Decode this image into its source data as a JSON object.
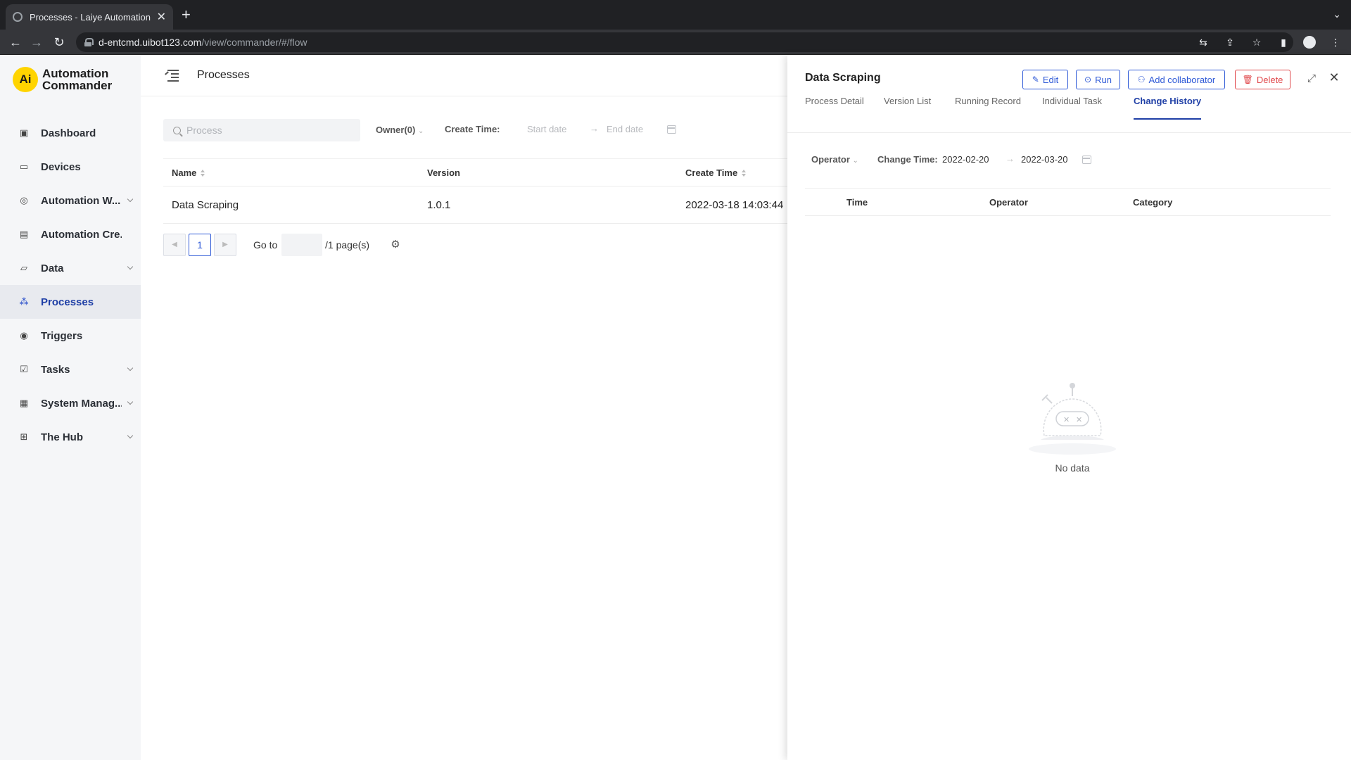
{
  "browser": {
    "tab_title": "Processes - Laiye Automation",
    "url_host": "d-entcmd.uibot123.com",
    "url_path": "/view/commander/#/flow"
  },
  "sidebar": {
    "logo_mark": "Ai",
    "logo_line1": "Automation",
    "logo_line2": "Commander",
    "items": [
      {
        "label": "Dashboard",
        "icon": "dashboard-icon",
        "has_caret": false,
        "active": false
      },
      {
        "label": "Devices",
        "icon": "devices-icon",
        "has_caret": false,
        "active": false
      },
      {
        "label": "Automation W...",
        "icon": "automation-workflow-icon",
        "has_caret": true,
        "active": false
      },
      {
        "label": "Automation Cre...",
        "icon": "automation-creator-icon",
        "has_caret": false,
        "active": false
      },
      {
        "label": "Data",
        "icon": "data-folder-icon",
        "has_caret": true,
        "active": false
      },
      {
        "label": "Processes",
        "icon": "processes-icon",
        "has_caret": false,
        "active": true
      },
      {
        "label": "Triggers",
        "icon": "triggers-icon",
        "has_caret": false,
        "active": false
      },
      {
        "label": "Tasks",
        "icon": "tasks-icon",
        "has_caret": true,
        "active": false
      },
      {
        "label": "System Manag...",
        "icon": "system-management-icon",
        "has_caret": true,
        "active": false
      },
      {
        "label": "The Hub",
        "icon": "hub-icon",
        "has_caret": true,
        "active": false
      }
    ]
  },
  "header": {
    "title": "Processes"
  },
  "filters": {
    "search_placeholder": "Process",
    "owner_label": "Owner(0)",
    "create_time_label": "Create Time:",
    "start_placeholder": "Start date",
    "end_placeholder": "End date"
  },
  "table": {
    "columns": [
      "Name",
      "Version",
      "Create Time"
    ],
    "rows": [
      {
        "name": "Data Scraping",
        "version": "1.0.1",
        "create_time": "2022-03-18 14:03:44"
      }
    ]
  },
  "pagination": {
    "current_page": "1",
    "goto_label": "Go to",
    "pages_label": "/1 page(s)"
  },
  "drawer": {
    "title": "Data Scraping",
    "buttons": {
      "edit": "Edit",
      "run": "Run",
      "add_collaborator": "Add collaborator",
      "delete": "Delete"
    },
    "tabs": [
      "Process Detail",
      "Version List",
      "Running Record",
      "Individual Task",
      "Change History"
    ],
    "active_tab": "Change History",
    "filters": {
      "operator_label": "Operator",
      "change_time_label": "Change Time:",
      "start_date": "2022-02-20",
      "end_date": "2022-03-20"
    },
    "columns": [
      "Time",
      "Operator",
      "Category"
    ],
    "empty_text": "No data"
  },
  "colors": {
    "accent": "#2f5ad7",
    "active_nav": "#1f3fa6",
    "danger": "#e0484b",
    "logo_yellow": "#ffd400"
  }
}
